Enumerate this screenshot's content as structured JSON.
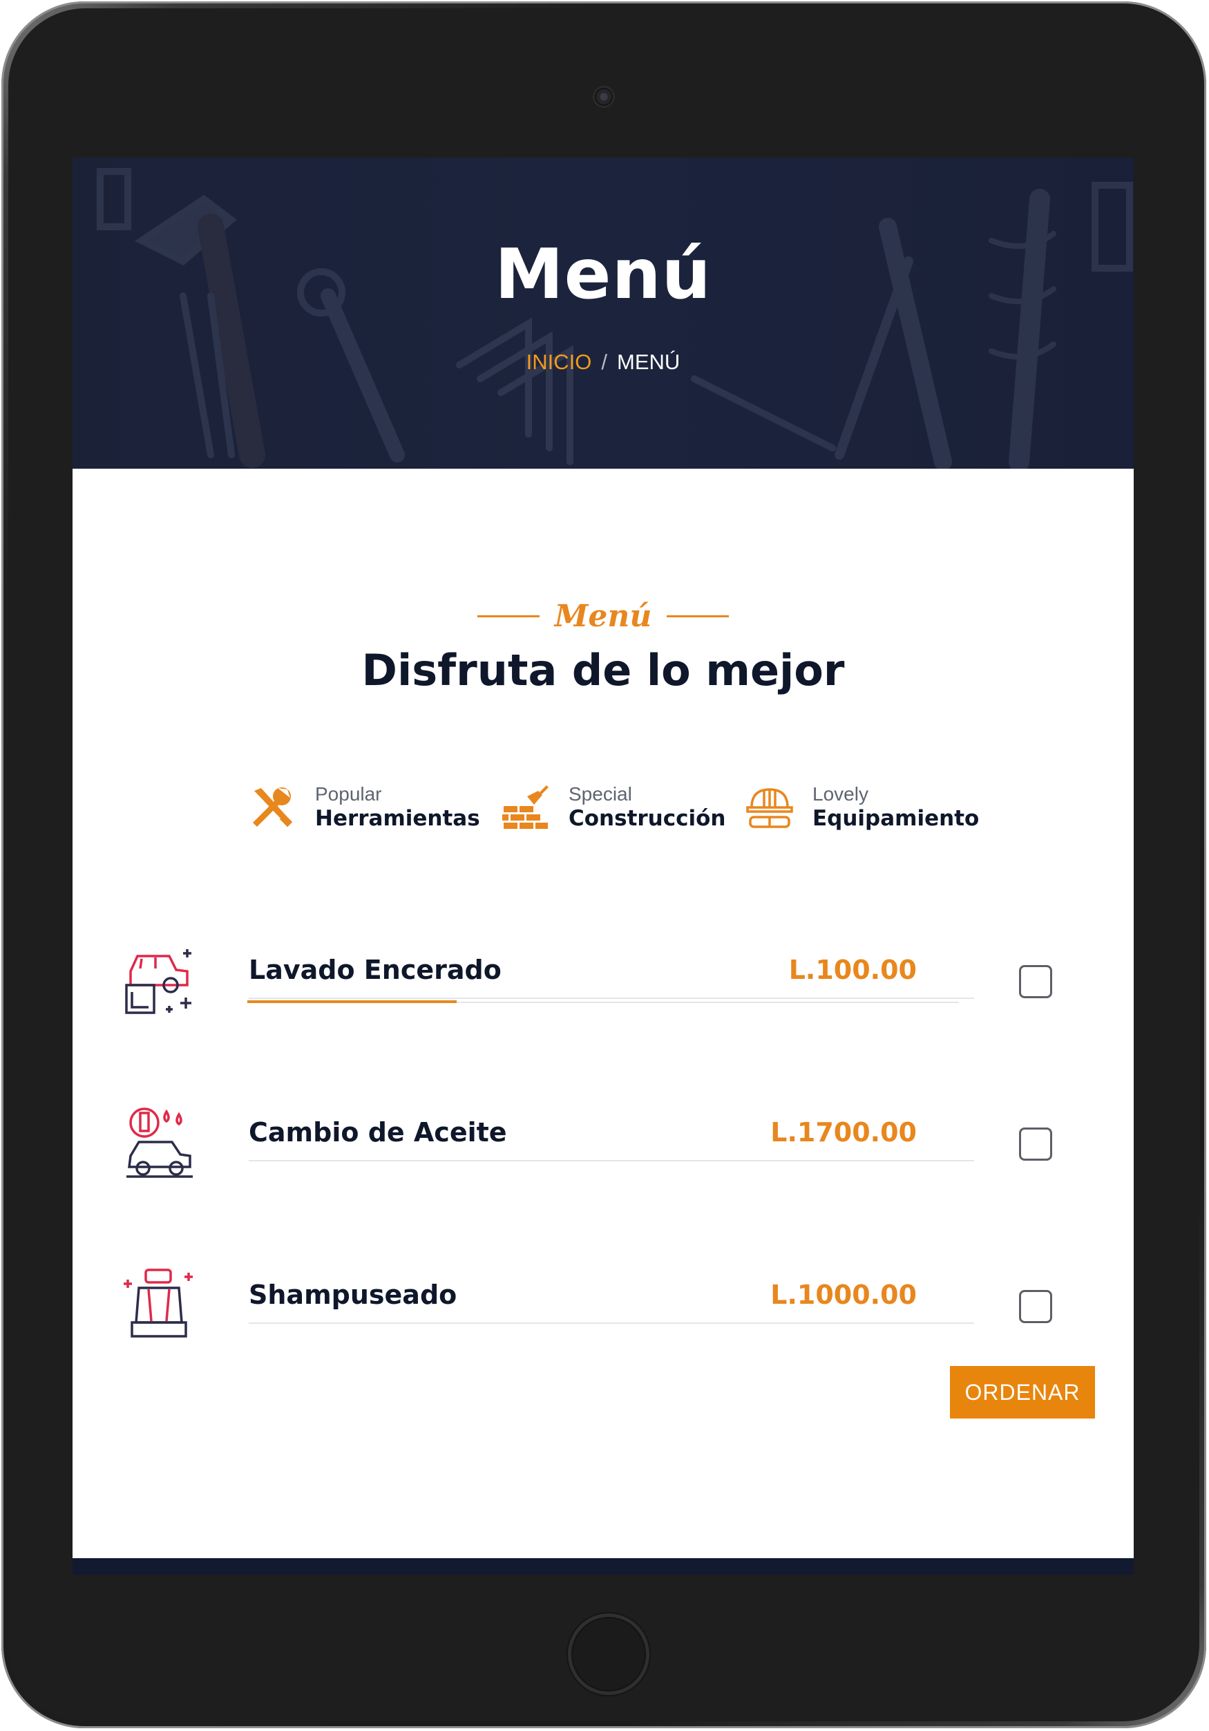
{
  "hero": {
    "title": "Menú",
    "breadcrumb_home": "INICIO",
    "breadcrumb_sep": "/",
    "breadcrumb_current": "MENÚ"
  },
  "section": {
    "tag": "Menú",
    "title": "Disfruta de lo mejor"
  },
  "tabs": [
    {
      "small": "Popular",
      "big": "Herramientas",
      "icon": "wrench-screwdriver-icon"
    },
    {
      "small": "Special",
      "big": "Construcción",
      "icon": "brick-wall-trowel-icon"
    },
    {
      "small": "Lovely",
      "big": "Equipamiento",
      "icon": "hard-hat-goggles-icon"
    }
  ],
  "items": [
    {
      "name": "Lavado Encerado",
      "price": "L.100.00",
      "icon": "car-wash-icon"
    },
    {
      "name": "Cambio de Aceite",
      "price": "L.1700.00",
      "icon": "car-oil-change-icon"
    },
    {
      "name": "Shampuseado",
      "price": "L.1000.00",
      "icon": "car-seat-icon"
    }
  ],
  "order_button": "ORDENAR",
  "colors": {
    "accent": "#e8871e",
    "dark": "#0f172b",
    "hero_bg": "#1c2238",
    "icon_red": "#e0294a"
  }
}
